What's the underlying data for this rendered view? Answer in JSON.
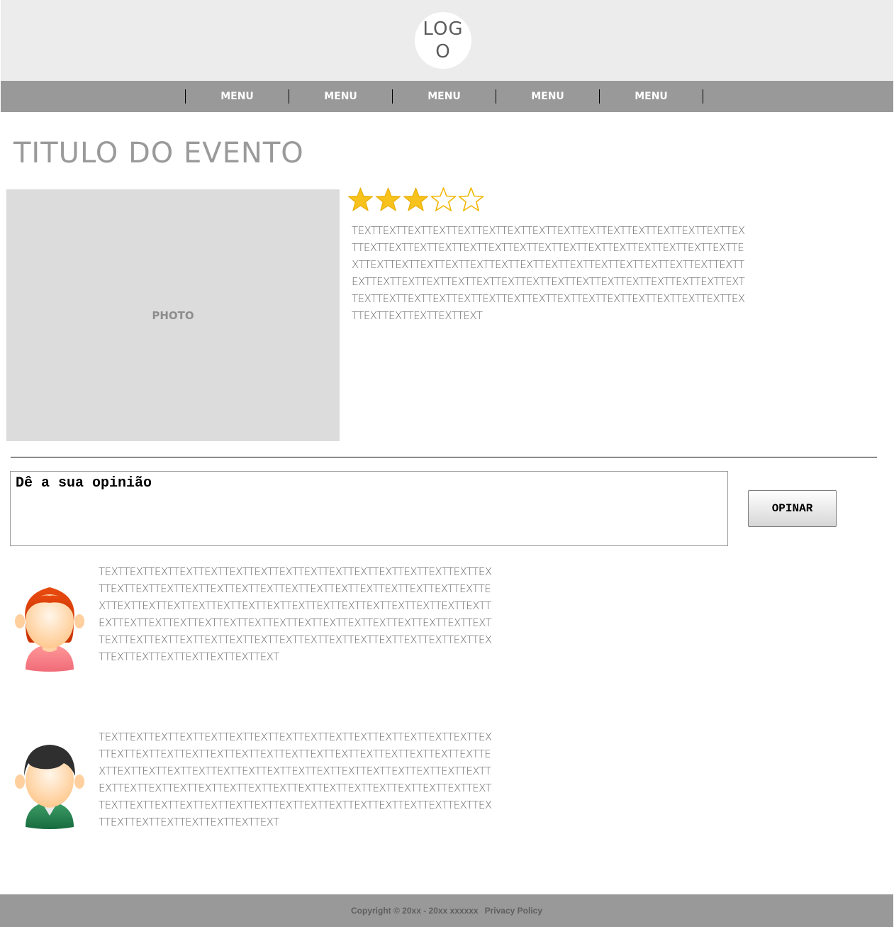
{
  "header": {
    "logo_text": "LOGO"
  },
  "nav": {
    "items": [
      "MENU",
      "MENU",
      "MENU",
      "MENU",
      "MENU"
    ]
  },
  "event": {
    "title": "TITULO DO EVENTO",
    "photo_label": "PHOTO",
    "rating": 3,
    "rating_max": 5,
    "description": "TEXTTEXTTEXTTEXTTEXTTEXTTEXTTEXTTEXTTEXTTEXTTEXTTEXTTEXTTEXTTEXTTEXTTEXTTEXTTEXTTEXTTEXTTEXTTEXTTEXTTEXTTEXTTEXTTEXTTEXTTEXTTEXTTEXTTEXTTEXTTEXTTEXTTEXTTEXTTEXTTEXTTEXTTEXTTEXTTEXTTEXTTEXTTEXTTEXTTEXTTEXTTEXTTEXTTEXTTEXTTEXTTEXTTEXTTEXTTEXTTEXTTEXTTEXTTEXTTEXTTEXTTEXTTEXTTEXTTEXTTEXTTEXTTEXTTEXTTEXTTEXTTEXTTEXTTEXTTEXTTEXTTEXTTEXTTEXT"
  },
  "opinion": {
    "text": "Dê a sua opinião",
    "button_label": "OPINAR"
  },
  "comments": [
    {
      "avatar": "female-avatar-icon",
      "text": "TEXTTEXTTEXTTEXTTEXTTEXTTEXTTEXTTEXTTEXTTEXTTEXTTEXTTEXTTEXTTEXTTEXTTEXTTEXTTEXTTEXTTEXTTEXTTEXTTEXTTEXTTEXTTEXTTEXTTEXTTEXTTEXTTEXTTEXTTEXTTEXTTEXTTEXTTEXTTEXTTEXTTEXTTEXTTEXTTEXTTEXTTEXTTEXTTEXTTEXTTEXTTEXTTEXTTEXTTEXTTEXTTEXTTEXTTEXTTEXTTEXTTEXTTEXTTEXTTEXTTEXTTEXTTEXTTEXTTEXTTEXTTEXTTEXTTEXTTEXTTEXTTEXTTEXTTEXTTEXTTEXTTEXTTEXTTEXTTEXTTEXT"
    },
    {
      "avatar": "male-avatar-icon",
      "text": "TEXTTEXTTEXTTEXTTEXTTEXTTEXTTEXTTEXTTEXTTEXTTEXTTEXTTEXTTEXTTEXTTEXTTEXTTEXTTEXTTEXTTEXTTEXTTEXTTEXTTEXTTEXTTEXTTEXTTEXTTEXTTEXTTEXTTEXTTEXTTEXTTEXTTEXTTEXTTEXTTEXTTEXTTEXTTEXTTEXTTEXTTEXTTEXTTEXTTEXTTEXTTEXTTEXTTEXTTEXTTEXTTEXTTEXTTEXTTEXTTEXTTEXTTEXTTEXTTEXTTEXTTEXTTEXTTEXTTEXTTEXTTEXTTEXTTEXTTEXTTEXTTEXTTEXTTEXTTEXTTEXTTEXTTEXTTEXTTEXTTEXT"
    }
  ],
  "footer": {
    "copyright": "Copyright © 20xx - 20xx xxxxxx",
    "privacy_label": "Privacy Policy"
  },
  "colors": {
    "header_bg": "#ececec",
    "nav_bg": "#999999",
    "photo_bg": "#dcdcdc",
    "star_fill": "#f5b800",
    "title_gray": "#9a9a9a"
  }
}
